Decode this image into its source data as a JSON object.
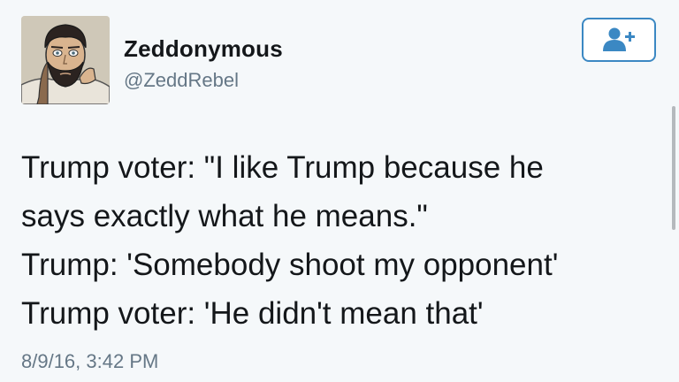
{
  "user": {
    "display_name": "Zeddonymous",
    "handle": "@ZeddRebel"
  },
  "follow_button": {
    "icon": "add-user-icon",
    "color": "#3b88c3"
  },
  "tweet": {
    "lines": [
      "Trump voter: \"I like Trump because he",
      "says exactly what he means.\"",
      "Trump: 'Somebody shoot my opponent'",
      "Trump voter: 'He didn't mean that'"
    ],
    "timestamp": "8/9/16, 3:42 PM"
  },
  "colors": {
    "background": "#f5f8fa",
    "text": "#14171a",
    "secondary": "#657786",
    "accent": "#3b88c3"
  }
}
